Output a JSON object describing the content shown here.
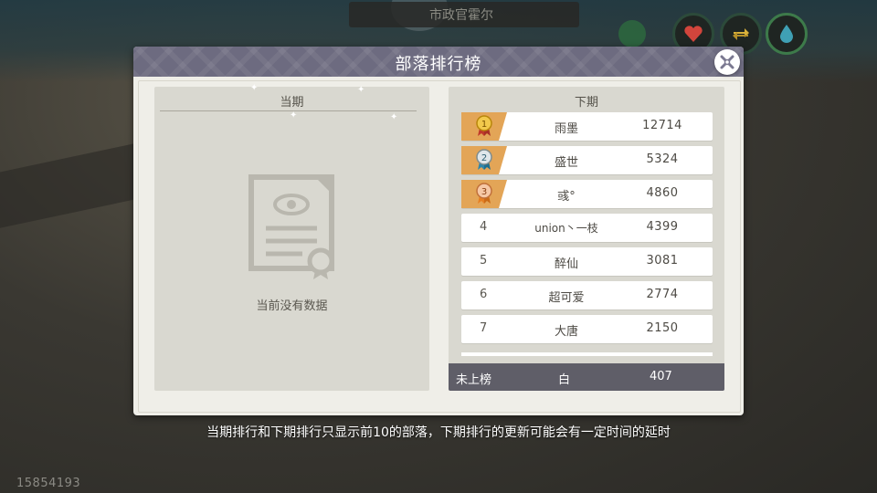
{
  "npc": {
    "name": "市政官霍尔"
  },
  "hud": {
    "icons": [
      "heart-icon",
      "arrows-icon",
      "water-drop-icon"
    ]
  },
  "dialog": {
    "title": "部落排行榜",
    "current": {
      "title": "当期",
      "empty_text": "当前没有数据"
    },
    "next": {
      "title": "下期",
      "rows": [
        {
          "rank": "1",
          "name": "雨墨",
          "score": "12714",
          "medal": "gold"
        },
        {
          "rank": "2",
          "name": "盛世",
          "score": "5324",
          "medal": "silver"
        },
        {
          "rank": "3",
          "name": "彧°",
          "score": "4860",
          "medal": "bronze"
        },
        {
          "rank": "4",
          "name": "union丶一枝",
          "score": "4399"
        },
        {
          "rank": "5",
          "name": "醉仙",
          "score": "3081"
        },
        {
          "rank": "6",
          "name": "超可爱",
          "score": "2774"
        },
        {
          "rank": "7",
          "name": "大唐",
          "score": "2150"
        }
      ],
      "unranked": {
        "label": "未上榜",
        "name": "白",
        "score": "407"
      }
    }
  },
  "notice": "当期排行和下期排行只显示前10的部落，下期排行的更新可能会有一定时间的延时",
  "uid": "15854193",
  "colors": {
    "header": "#6d6b80",
    "rank_tag": "#e3a557",
    "unranked_bar": "#5f5e68"
  }
}
